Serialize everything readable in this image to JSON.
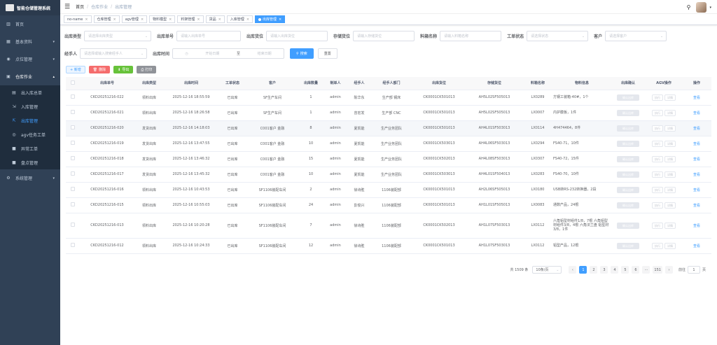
{
  "app": {
    "title": "智能仓储管理系统"
  },
  "menu": {
    "home": "首页",
    "basic": "基本资料",
    "points": "点位管理",
    "ops": "仓库作业",
    "ops_items": [
      {
        "label": "出入库总单",
        "icon": "list-icon"
      },
      {
        "label": "入库管理",
        "icon": "inbound-icon"
      },
      {
        "label": "出库管理",
        "icon": "outbound-icon"
      },
      {
        "label": "agv任务工单",
        "icon": "agv-icon"
      },
      {
        "label": "异常工单",
        "icon": "alert-icon"
      },
      {
        "label": "盘点管理",
        "icon": "check-icon"
      }
    ],
    "sys": "系统管理"
  },
  "breadcrumb": [
    "首页",
    "仓库作业",
    "出库管理"
  ],
  "tags": [
    {
      "label": "no-name"
    },
    {
      "label": "仓库管理"
    },
    {
      "label": "agv管理"
    },
    {
      "label": "物料模型"
    },
    {
      "label": "料架管理"
    },
    {
      "label": "货品"
    },
    {
      "label": "入库管理"
    },
    {
      "label": "出库管理",
      "active": true
    }
  ],
  "filters": {
    "out_type": {
      "label": "出库类型",
      "placeholder": "请选择出库类型"
    },
    "out_no": {
      "label": "出库单号",
      "placeholder": "请输入出库单号"
    },
    "out_loc": {
      "label": "出库货位",
      "placeholder": "请输入出库货位"
    },
    "stock_loc": {
      "label": "存储货位",
      "placeholder": "请输入存储货位"
    },
    "material": {
      "label": "料箱名称",
      "placeholder": "请输入料箱名称"
    },
    "status": {
      "label": "工单状态",
      "placeholder": "请选择状态"
    },
    "customer": {
      "label": "客户",
      "placeholder": "请选择客户"
    },
    "handler": {
      "label": "经手人",
      "placeholder": "请选择或输入搜索经手人"
    },
    "time": {
      "label": "出库时间",
      "start": "开始日期",
      "sep": "至",
      "end": "结束日期"
    },
    "search_btn": "搜索",
    "reset_btn": "重置"
  },
  "toolbar": {
    "add": "+ 新增",
    "delete": "删除",
    "export": "导出",
    "print": "打印"
  },
  "table": {
    "headers": [
      "",
      "出库单号",
      "出库类型",
      "出库时间",
      "工单状态",
      "客户",
      "出库数量",
      "制单人",
      "经手人",
      "经手人部门",
      "出库货位",
      "存储货位",
      "料箱名称",
      "物料信息",
      "出库确认",
      "AGV操作",
      "操作"
    ],
    "confirm_btn": "确认出库",
    "agv_a": "执行",
    "agv_b": "详情",
    "view": "查看",
    "rows": [
      {
        "no": "CKD20251216-022",
        "type": "领料出库",
        "time": "2025-12-16 18:55:59",
        "status": "已出库",
        "cust": "SF生产车间",
        "qty": "1",
        "maker": "admin",
        "handler": "陈华东",
        "dept": "生产部 钢床",
        "out": "CK0001CK501013",
        "store": "AH5L02SF505013",
        "box": "LX0289",
        "info": "方钢工装箱-40#，1个"
      },
      {
        "no": "CKD20251216-021",
        "type": "领料出库",
        "time": "2025-12-16 18:26:58",
        "status": "已出库",
        "cust": "SF生产车间",
        "qty": "1",
        "maker": "admin",
        "handler": "曾宏发",
        "dept": "生产部 CNC",
        "out": "CK0001CK501013",
        "store": "AH5L02SF505013",
        "box": "LX0007",
        "info": "内护膜板，1件"
      },
      {
        "no": "CKD20251216-020",
        "type": "发货出库",
        "time": "2025-12-16 14:18:03",
        "status": "已出库",
        "cust": "C001客户 金融",
        "qty": "8",
        "maker": "admin",
        "handler": "夏凯能",
        "dept": "生产业务团队",
        "out": "CK0001CK501013",
        "store": "AH4L01SF503013",
        "box": "LX0114",
        "info": "4H474464，8件"
      },
      {
        "no": "CKD20251216-019",
        "type": "发货出库",
        "time": "2025-12-16 13:47:55",
        "status": "已出库",
        "cust": "C001客户 金融",
        "qty": "10",
        "maker": "admin",
        "handler": "夏凯能",
        "dept": "生产业务团队",
        "out": "CK0001CK503013",
        "store": "AH4L06SF503013",
        "box": "LX0294",
        "info": "FS40-71，10件"
      },
      {
        "no": "CKD20251216-018",
        "type": "发货出库",
        "time": "2025-12-16 13:46:32",
        "status": "已出库",
        "cust": "C001客户 金融",
        "qty": "15",
        "maker": "admin",
        "handler": "夏凯能",
        "dept": "生产业务团队",
        "out": "CK0001CK502013",
        "store": "AH4L08SF503013",
        "box": "LX0307",
        "info": "FS40-72，15件"
      },
      {
        "no": "CKD20251216-017",
        "type": "发货出库",
        "time": "2025-12-16 13:45:32",
        "status": "已出库",
        "cust": "C001客户 金融",
        "qty": "10",
        "maker": "admin",
        "handler": "夏凯能",
        "dept": "生产业务团队",
        "out": "CK0001CK503013",
        "store": "AH4L01SF504013",
        "box": "LX0283",
        "info": "FS40-70，10件"
      },
      {
        "no": "CKD20251216-016",
        "type": "领料出库",
        "time": "2025-12-16 10:43:53",
        "status": "已出库",
        "cust": "SF1106装配车间",
        "qty": "2",
        "maker": "admin",
        "handler": "徐诗胜",
        "dept": "1106装配部",
        "out": "CK0001CK501013",
        "store": "AH2L06SF505013",
        "box": "LX0180",
        "info": "USB转RS-232转换器，2段"
      },
      {
        "no": "CKD20251216-015",
        "type": "领料出库",
        "time": "2025-12-16 10:55:03",
        "status": "已出库",
        "cust": "SF1106装配车间",
        "qty": "24",
        "maker": "admin",
        "handler": "彭俊兴",
        "dept": "1106装配部",
        "out": "CK0001CK501013",
        "store": "AH1L01SF505013",
        "box": "LX0083",
        "info": "通数产品，24根"
      },
      {
        "no": "CKD20251216-013",
        "type": "领料出库",
        "time": "2025-12-16 10:20:28",
        "status": "已出库",
        "cust": "SF1106装配车间",
        "qty": "7",
        "maker": "admin",
        "handler": "徐诗胜",
        "dept": "1106装配部",
        "out": "CK0001CK502013",
        "store": "AH1L07SF503013",
        "box": "LX0112",
        "info": "六角铝型材组件1/8，7根 六角铝型材组件3/8，4根 六角法兰盘 铝型材 3/8，1件"
      },
      {
        "no": "CKD20251216-012",
        "type": "领料出库",
        "time": "2025-12-16 10:24:33",
        "status": "已出库",
        "cust": "SF1106装配车间",
        "qty": "12",
        "maker": "admin",
        "handler": "徐诗胜",
        "dept": "1106装配部",
        "out": "CK0001CK501013",
        "store": "AH1L07SF503013",
        "box": "LX0112",
        "info": "铝型产品，12根"
      }
    ]
  },
  "pager": {
    "total": "共 1509 条",
    "size": "10条/页",
    "pages": [
      "‹",
      "1",
      "2",
      "3",
      "4",
      "5",
      "6",
      "···",
      "151",
      "›"
    ],
    "active": "1",
    "goto_label": "前往",
    "goto_value": "1",
    "goto_unit": "页"
  },
  "colors": {
    "primary": "#409eff",
    "sidebar": "#304156"
  }
}
